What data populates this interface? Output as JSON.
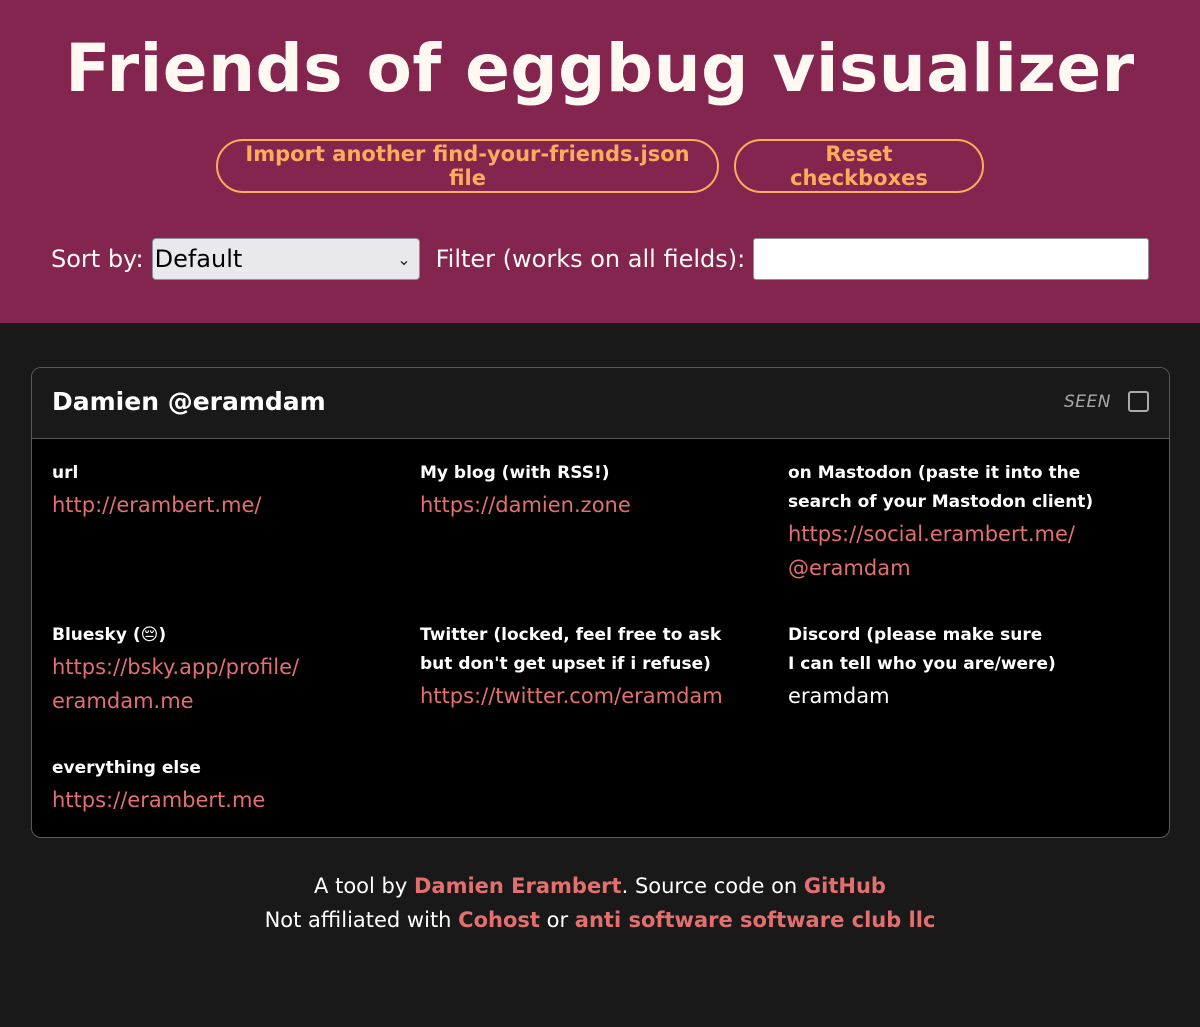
{
  "header": {
    "title": "Friends of eggbug visualizer",
    "import_button": "Import another find-your-friends.json file",
    "reset_button": "Reset checkboxes",
    "sort_label": "Sort by:",
    "sort_value": "Default",
    "filter_label": "Filter (works on all fields):",
    "filter_value": ""
  },
  "card": {
    "name": "Damien @eramdam",
    "seen_label": "SEEN",
    "seen_checked": false,
    "fields": [
      {
        "label": "url",
        "value": "http://erambert.me/"
      },
      {
        "label": "My blog (with RSS!)",
        "value": "https://damien.zone"
      },
      {
        "label_lines": [
          "on Mastodon (paste it into the",
          "search of your Mastodon client)"
        ],
        "value_lines": [
          "https://social.erambert.me/",
          "@eramdam"
        ]
      },
      {
        "label": "Bluesky (😔)",
        "value_lines": [
          "https://bsky.app/profile/",
          "eramdam.me"
        ]
      },
      {
        "label_lines": [
          "Twitter (locked, feel free to ask",
          "but don't get upset if i refuse)"
        ],
        "value": "https://twitter.com/eramdam"
      },
      {
        "label_lines": [
          "Discord (please make sure",
          "I can tell who you are/were)"
        ],
        "value": "eramdam"
      },
      {
        "label": "everything else",
        "value": "https://erambert.me"
      }
    ]
  },
  "footer": {
    "line1_prefix": "A tool by ",
    "author_link": "Damien Erambert",
    "line1_middle": ". Source code on ",
    "github_link": "GitHub",
    "line2_prefix": "Not affiliated with ",
    "cohost_link": "Cohost",
    "line2_middle": " or ",
    "asscllc_link": "anti software software club llc"
  }
}
